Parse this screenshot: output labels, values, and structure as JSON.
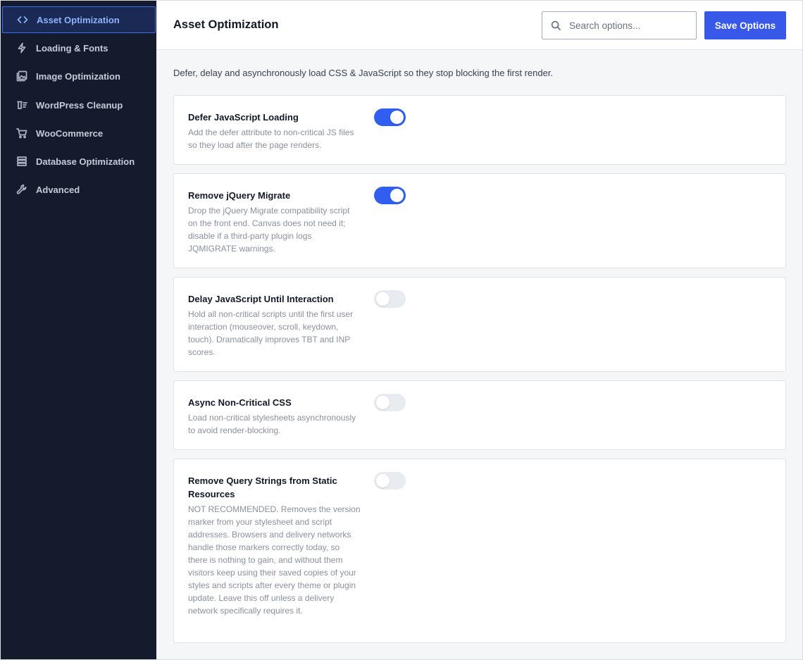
{
  "sidebar": {
    "items": [
      {
        "label": "Asset Optimization",
        "icon": "code-icon",
        "active": true
      },
      {
        "label": "Loading & Fonts",
        "icon": "bolt-icon",
        "active": false
      },
      {
        "label": "Image Optimization",
        "icon": "image-icon",
        "active": false
      },
      {
        "label": "WordPress Cleanup",
        "icon": "cleanup-icon",
        "active": false
      },
      {
        "label": "WooCommerce",
        "icon": "cart-icon",
        "active": false
      },
      {
        "label": "Database Optimization",
        "icon": "database-icon",
        "active": false
      },
      {
        "label": "Advanced",
        "icon": "wrench-icon",
        "active": false
      }
    ]
  },
  "header": {
    "title": "Asset Optimization",
    "search_placeholder": "Search options...",
    "save_label": "Save Options"
  },
  "intro": "Defer, delay and asynchronously load CSS & JavaScript so they stop blocking the first render.",
  "options": [
    {
      "title": "Defer JavaScript Loading",
      "description": "Add the defer attribute to non-critical JS files so they load after the page renders.",
      "enabled": true
    },
    {
      "title": "Remove jQuery Migrate",
      "description": "Drop the jQuery Migrate compatibility script on the front end. Canvas does not need it; disable if a third-party plugin logs JQMIGRATE warnings.",
      "enabled": true
    },
    {
      "title": "Delay JavaScript Until Interaction",
      "description": "Hold all non-critical scripts until the first user interaction (mouseover, scroll, keydown, touch). Dramatically improves TBT and INP scores.",
      "enabled": false
    },
    {
      "title": "Async Non-Critical CSS",
      "description": "Load non-critical stylesheets asynchronously to avoid render-blocking.",
      "enabled": false
    },
    {
      "title": "Remove Query Strings from Static Resources",
      "description": "NOT RECOMMENDED. Removes the version marker from your stylesheet and script addresses. Browsers and delivery networks handle those markers correctly today, so there is nothing to gain, and without them visitors keep using their saved copies of your styles and scripts after every theme or plugin update. Leave this off unless a delivery network specifically requires it.",
      "enabled": false
    }
  ],
  "colors": {
    "sidebar_bg": "#141b2d",
    "accent": "#3858e9",
    "toggle_on": "#2f5ef0",
    "toggle_off": "#e8ebf0"
  }
}
